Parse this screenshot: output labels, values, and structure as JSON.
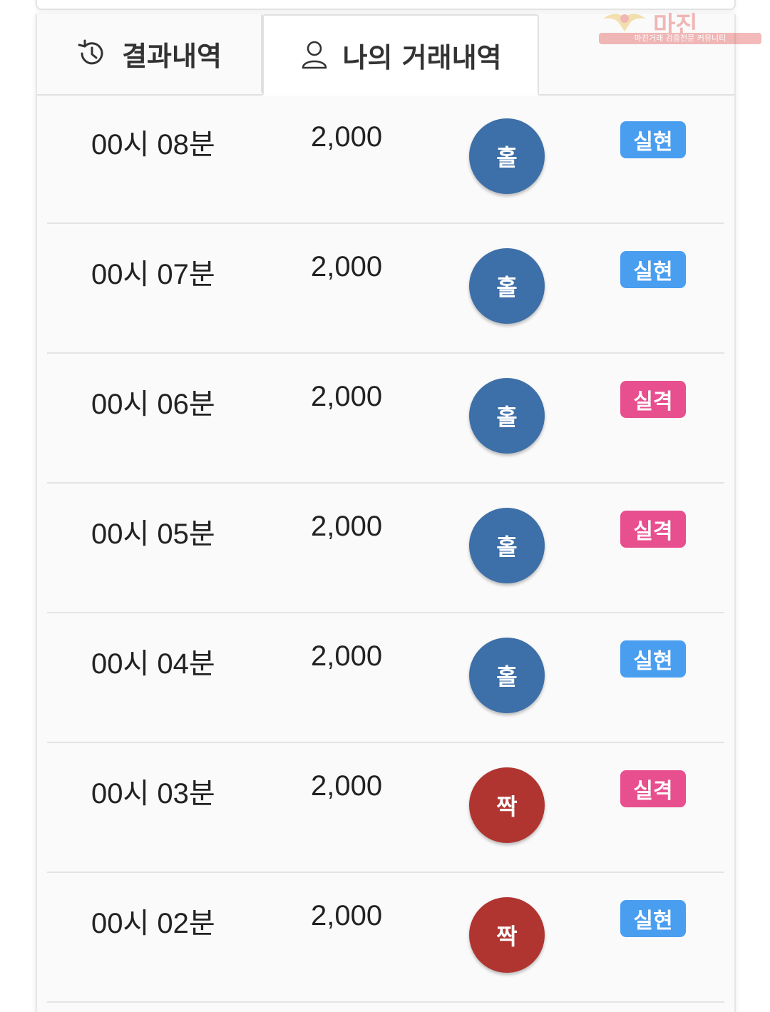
{
  "tabs": [
    {
      "label": "결과내역",
      "icon": "history-icon",
      "active": false
    },
    {
      "label": "나의 거래내역",
      "icon": "user-icon",
      "active": true
    }
  ],
  "watermark": {
    "title": "마진",
    "subtitle": "마진거래 검증전문 커뮤니티"
  },
  "rows": [
    {
      "time": "00시 08분",
      "amount": "2,000",
      "pick": "홀",
      "pick_type": "odd",
      "result": "실현",
      "result_type": "win"
    },
    {
      "time": "00시 07분",
      "amount": "2,000",
      "pick": "홀",
      "pick_type": "odd",
      "result": "실현",
      "result_type": "win"
    },
    {
      "time": "00시 06분",
      "amount": "2,000",
      "pick": "홀",
      "pick_type": "odd",
      "result": "실격",
      "result_type": "lose"
    },
    {
      "time": "00시 05분",
      "amount": "2,000",
      "pick": "홀",
      "pick_type": "odd",
      "result": "실격",
      "result_type": "lose"
    },
    {
      "time": "00시 04분",
      "amount": "2,000",
      "pick": "홀",
      "pick_type": "odd",
      "result": "실현",
      "result_type": "win"
    },
    {
      "time": "00시 03분",
      "amount": "2,000",
      "pick": "짝",
      "pick_type": "even",
      "result": "실격",
      "result_type": "lose"
    },
    {
      "time": "00시 02분",
      "amount": "2,000",
      "pick": "짝",
      "pick_type": "even",
      "result": "실현",
      "result_type": "win"
    }
  ],
  "colors": {
    "odd": "#3d6fa8",
    "even": "#b03530",
    "win": "#4a9ef0",
    "lose": "#e84f8f"
  }
}
